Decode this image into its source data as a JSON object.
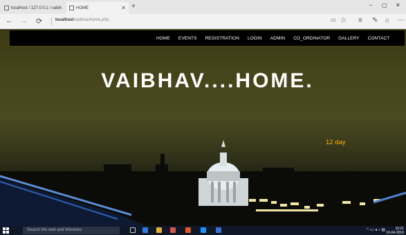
{
  "browser": {
    "tabs": [
      {
        "label": "localhost / 127.0.0.1 / vaibh",
        "active": false
      },
      {
        "label": "HOME",
        "active": true
      }
    ],
    "new_tab_label": "+",
    "url_host": "localhost",
    "url_path": "/vaibhav/home.php",
    "window_controls": {
      "minimize": "–",
      "maximize": "▢",
      "close": "✕"
    },
    "icons": [
      "back-arrow-icon",
      "forward-arrow-icon",
      "refresh-icon",
      "reading-view-icon",
      "favorite-star-icon",
      "hub-icon",
      "web-note-icon",
      "share-icon",
      "more-icon"
    ]
  },
  "site": {
    "nav": [
      "HOME",
      "EVENTS",
      "REGISTRATION",
      "LOGIN",
      "ADMIN",
      "CO_ORDINATOR",
      "GALLERY",
      "CONTACT"
    ],
    "hero_title": "VAIBHAV....HOME.",
    "countdown": "12 day"
  },
  "taskbar": {
    "search_placeholder": "Search the web and Windows",
    "time": "15:21",
    "date": "10-04-2016"
  },
  "colors": {
    "accent": "#ffb300",
    "nav_bg": "#000000",
    "taskbar_bg": "#101828"
  }
}
